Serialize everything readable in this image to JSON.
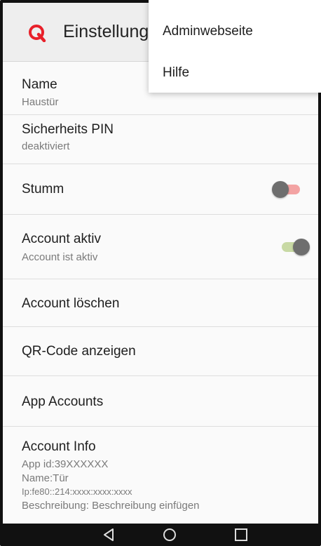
{
  "app": {
    "title": "Einstellung",
    "logo_letter": "Q",
    "accent_color": "#e8202a"
  },
  "menu": {
    "items": [
      {
        "label": "Adminwebseite"
      },
      {
        "label": "Hilfe"
      }
    ]
  },
  "settings": {
    "name": {
      "title": "Name",
      "value": "Haustür"
    },
    "pin": {
      "title": "Sicherheits PIN",
      "value": "deaktiviert"
    },
    "mute": {
      "title": "Stumm",
      "enabled": false
    },
    "account_active": {
      "title": "Account aktiv",
      "value": "Account ist aktiv",
      "enabled": true
    },
    "delete_account": {
      "title": "Account löschen"
    },
    "qr_code": {
      "title": "QR-Code anzeigen"
    },
    "app_accounts": {
      "title": "App Accounts"
    },
    "account_info": {
      "title": "Account Info",
      "app_id": "App id:39XXXXXX",
      "name": "Name:Tür",
      "ip": "Ip:fe80::214:xxxx:xxxx:xxxx",
      "description": "Beschreibung: Beschreibung einfügen"
    }
  },
  "navbar": {
    "buttons": [
      "back-icon",
      "home-icon",
      "recent-apps-icon"
    ]
  }
}
